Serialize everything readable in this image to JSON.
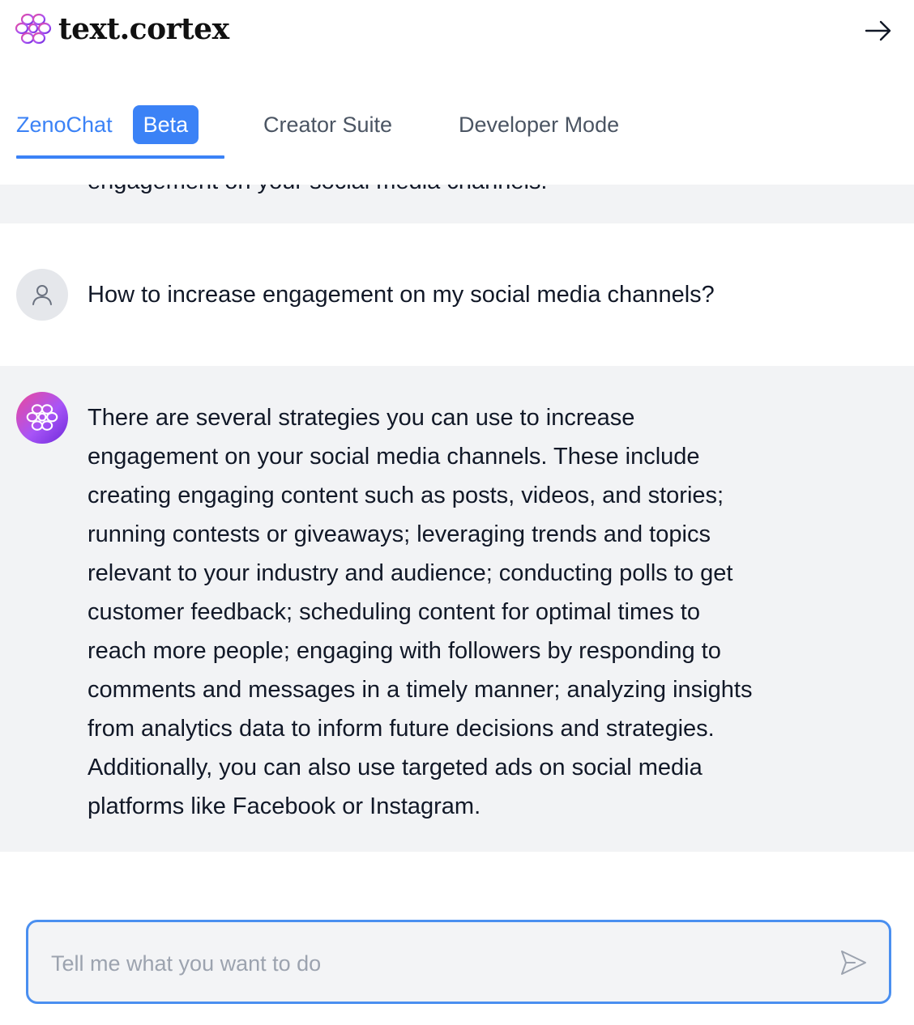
{
  "header": {
    "brand": "text.cortex",
    "logo_icon": "brain-icon",
    "exit_icon": "arrow-right-icon"
  },
  "tabs": [
    {
      "label": "ZenoChat",
      "badge": "Beta",
      "active": true
    },
    {
      "label": "Creator Suite",
      "active": false
    },
    {
      "label": "Developer Mode",
      "active": false
    }
  ],
  "chat": {
    "previous_fragment": "engagement on your social media channels.",
    "user_message": "How to increase engagement on my social media channels?",
    "assistant_lines": [
      "There are several strategies you can use to increase",
      "engagement on your social media channels. These include",
      "creating engaging content such as posts, videos, and stories;",
      "running contests or giveaways; leveraging trends and topics",
      "relevant to your industry and audience; conducting polls to get",
      "customer feedback; scheduling content for optimal times to",
      "reach more people; engaging with followers by responding to",
      "comments and messages in a timely manner; analyzing insights",
      "from analytics data to inform future decisions and strategies.",
      "Additionally, you can also use targeted ads on social media",
      "platforms like Facebook or Instagram."
    ]
  },
  "composer": {
    "placeholder": "Tell me what you want to do",
    "value": "",
    "send_icon": "send-icon"
  },
  "colors": {
    "accent": "#3b82f6",
    "assistant_bg": "#f2f3f5",
    "avatar_gradient": [
      "#ec4899",
      "#6d28d9"
    ]
  }
}
